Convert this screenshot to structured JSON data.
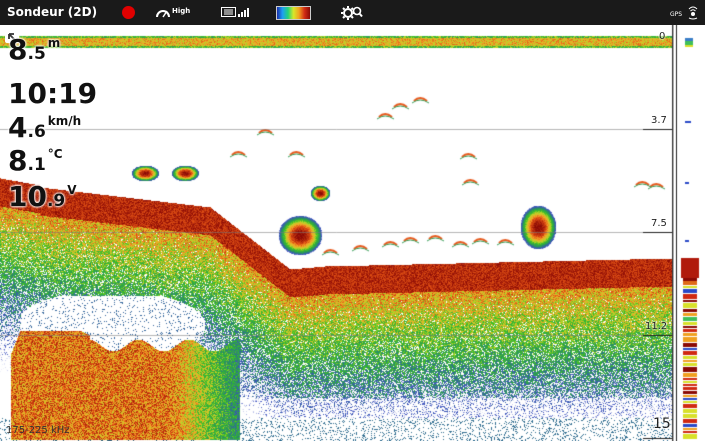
{
  "header": {
    "title": "Sondeur (2D)",
    "record_color": "#e00000",
    "sensitivity": "High",
    "gps_label": "GPS"
  },
  "readouts": {
    "depth": {
      "int": "8",
      "dec": ".5",
      "unit": "m"
    },
    "time": "10:19",
    "speed": {
      "int": "4",
      "dec": ".6",
      "unit": "km/h"
    },
    "temperature": {
      "int": "8",
      "dec": ".1",
      "unit": "°C"
    },
    "voltage": {
      "int": "10",
      "dec": ".9",
      "unit": "V"
    }
  },
  "depth_scale": [
    "0",
    "3.7",
    "7.5",
    "11.2",
    "15"
  ],
  "frequency": "175-225 kHz",
  "icons": [
    "back-arrow-icon",
    "record-icon",
    "sensitivity-gauge-icon",
    "sd-card-icon",
    "signal-icon",
    "palette-icon",
    "settings-search-icon",
    "gps-icon"
  ]
}
